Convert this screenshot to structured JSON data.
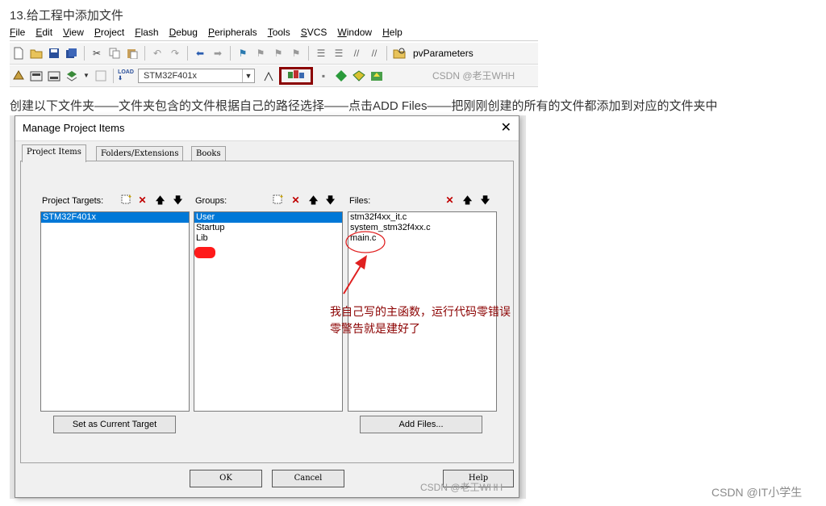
{
  "heading": "13.给工程中添加文件",
  "menu": [
    "File",
    "Edit",
    "View",
    "Project",
    "Flash",
    "Debug",
    "Peripherals",
    "Tools",
    "SVCS",
    "Window",
    "Help"
  ],
  "toolbar1": {
    "param_label": "pvParameters"
  },
  "toolbar2": {
    "target_value": "STM32F401x"
  },
  "watermark_top": "CSDN @老王WHH",
  "description": "创建以下文件夹——文件夹包含的文件根据自己的路径选择——点击ADD Files——把刚刚创建的所有的文件都添加到对应的文件夹中",
  "dialog": {
    "title": "Manage Project Items",
    "close": "✕",
    "tabs": [
      "Project Items",
      "Folders/Extensions",
      "Books"
    ],
    "targets": {
      "label": "Project Targets:",
      "items": [
        "STM32F401x"
      ]
    },
    "groups": {
      "label": "Groups:",
      "items": [
        "User",
        "Startup",
        "Lib"
      ]
    },
    "files": {
      "label": "Files:",
      "items": [
        "stm32f4xx_it.c",
        "system_stm32f4xx.c",
        "main.c"
      ]
    },
    "set_target_button": "Set as Current Target",
    "add_files_button": "Add Files...",
    "ok_button": "OK",
    "cancel_button": "Cancel",
    "help_button": "Help"
  },
  "annotation": "我自己写的主函数，运行代码零错误零警告就是建好了",
  "watermark_dialog": "CSDN @老王WHH",
  "watermark_bottom": "CSDN @IT小学生",
  "colors": {
    "annotation": "#8b0000",
    "selection": "#0078d7",
    "delete_icon": "#c00000"
  }
}
